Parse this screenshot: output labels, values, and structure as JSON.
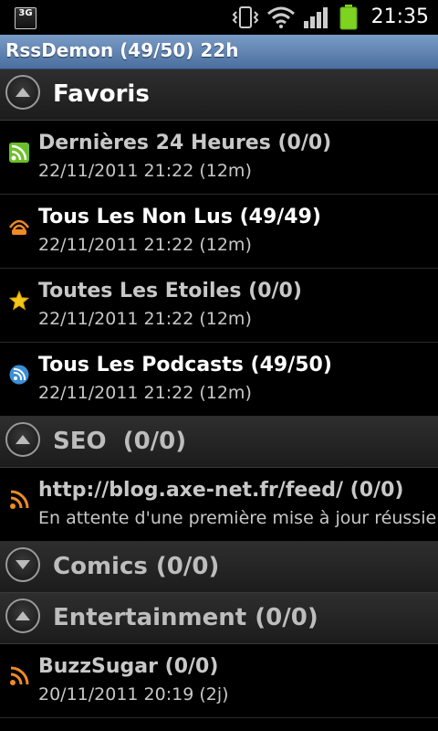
{
  "status_bar": {
    "network_top": "3G",
    "network_bottom": "",
    "time": "21:35"
  },
  "app_title": "RssDemon (49/50) 22h",
  "groups": [
    {
      "label": "Favoris",
      "expanded": true,
      "feeds": [
        {
          "title": "Dernières 24 Heures (0/0)",
          "subtitle": "22/11/2011 21:22 (12m)",
          "icon": "rss-square-icon",
          "unread": false
        },
        {
          "title": "Tous Les Non Lus (49/49)",
          "subtitle": "22/11/2011 21:22 (12m)",
          "icon": "unread-feed-icon",
          "unread": true
        },
        {
          "title": "Toutes Les Etoiles (0/0)",
          "subtitle": "22/11/2011 21:22 (12m)",
          "icon": "star-icon",
          "unread": false
        },
        {
          "title": "Tous Les Podcasts (49/50)",
          "subtitle": "22/11/2011 21:22 (12m)",
          "icon": "podcast-icon",
          "unread": true
        }
      ]
    },
    {
      "label": "SEO  (0/0)",
      "expanded": true,
      "feeds": [
        {
          "title": "http://blog.axe-net.fr/feed/ (0/0)",
          "subtitle": "En attente d'une première mise à jour réussie",
          "icon": "rss-icon",
          "unread": false
        }
      ]
    },
    {
      "label": "Comics (0/0)",
      "expanded": false,
      "feeds": []
    },
    {
      "label": "Entertainment (0/0)",
      "expanded": true,
      "feeds": [
        {
          "title": "BuzzSugar (0/0)",
          "subtitle": "20/11/2011 20:19 (2j)",
          "icon": "rss-icon",
          "unread": false
        }
      ]
    }
  ],
  "colors": {
    "title_bar": "#5b7fb0",
    "rss_orange": "#f08a24",
    "star_yellow": "#f5c518",
    "podcast_blue": "#3a8fd8",
    "rss_green": "#6cbf2a"
  }
}
